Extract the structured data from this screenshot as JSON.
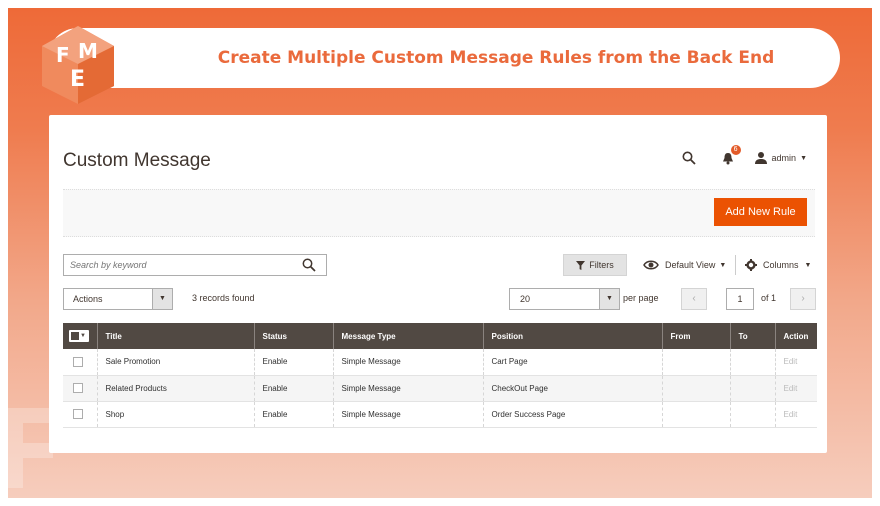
{
  "banner": {
    "title": "Create Multiple Custom Message Rules from the Back End",
    "logo_text": "FME"
  },
  "header": {
    "page_title": "Custom Message",
    "notification_count": "6",
    "user_name": "admin"
  },
  "toolbar": {
    "add_new_rule_label": "Add New Rule"
  },
  "search": {
    "placeholder": "Search by keyword"
  },
  "controls": {
    "filters_label": "Filters",
    "default_view_label": "Default View",
    "columns_label": "Columns",
    "actions_label": "Actions",
    "records_found": "3 records found",
    "per_page_value": "20",
    "per_page_label": "per page",
    "current_page": "1",
    "of_pages": "of 1"
  },
  "grid": {
    "columns": [
      "Title",
      "Status",
      "Message Type",
      "Position",
      "From",
      "To",
      "Action"
    ],
    "rows": [
      {
        "title": "Sale Promotion",
        "status": "Enable",
        "message_type": "Simple Message",
        "position": "Cart Page",
        "from": "",
        "to": "",
        "action": "Edit"
      },
      {
        "title": "Related Products",
        "status": "Enable",
        "message_type": "Simple Message",
        "position": "CheckOut Page",
        "from": "",
        "to": "",
        "action": "Edit"
      },
      {
        "title": "Shop",
        "status": "Enable",
        "message_type": "Simple Message",
        "position": "Order Success Page",
        "from": "",
        "to": "",
        "action": "Edit"
      }
    ]
  },
  "colors": {
    "brand_orange": "#eb5202",
    "banner_text": "#ea6a3c",
    "grid_header": "#514943"
  },
  "icons": {
    "search": "search-icon",
    "notifications": "bell-icon",
    "user": "user-icon",
    "filter": "funnel-icon",
    "view": "eye-icon",
    "columns": "gear-icon"
  }
}
